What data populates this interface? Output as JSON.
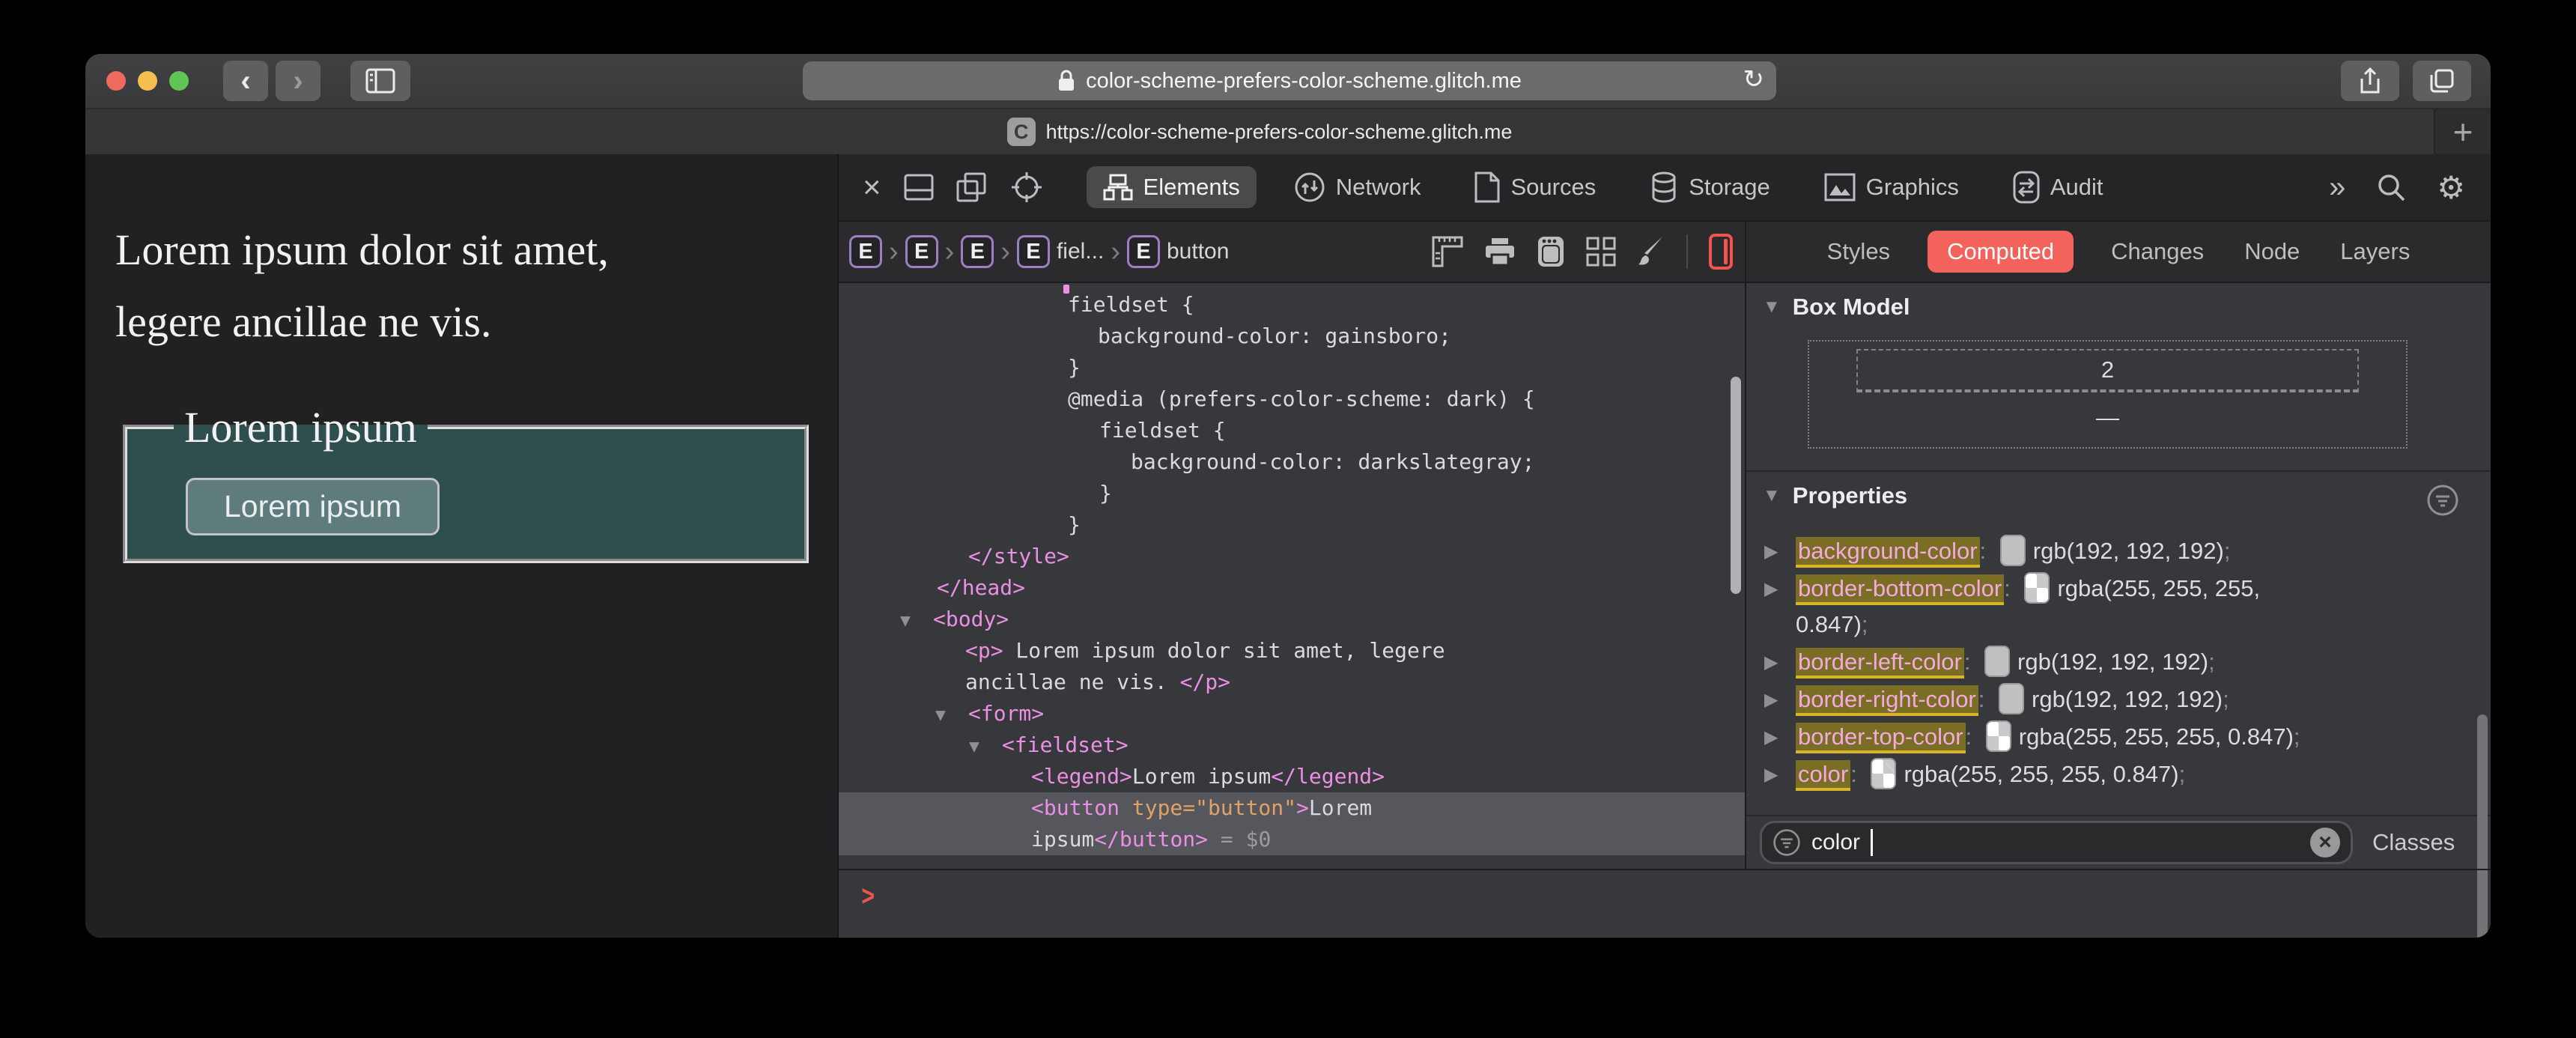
{
  "colors": {
    "computed-tab": "#f3625b",
    "prompt": "#f2544d",
    "tag-pink": "#ea8fe3",
    "attr-orange": "#e2a266",
    "highlight-bg": "#7a6e25",
    "highlight-underline": "#d9b32a",
    "prop-pink": "#f4a9df",
    "fieldset-bg": "#2f4f4f",
    "button-bg": "#5e7c7b",
    "button-border": "#c3c3c3"
  },
  "glyphs": {
    "back": "‹",
    "forward": "›",
    "reload": "↻",
    "plus": "+",
    "close": "×",
    "overflow": "»",
    "gear": "⚙",
    "separator": "›",
    "prompt": ">",
    "clear": "×",
    "collapse": "▼",
    "expand": "▶"
  },
  "titlebar": {
    "url": "color-scheme-prefers-color-scheme.glitch.me"
  },
  "tabbar": {
    "favicon_letter": "C",
    "tab_url": "https://color-scheme-prefers-color-scheme.glitch.me"
  },
  "page": {
    "paragraph": "Lorem ipsum dolor sit amet, legere ancillae ne vis.",
    "fieldset_legend": "Lorem ipsum",
    "button_label": "Lorem ipsum"
  },
  "devtools": {
    "toolbar": {
      "tabs": [
        {
          "label": "Elements",
          "active": true
        },
        {
          "label": "Network"
        },
        {
          "label": "Sources"
        },
        {
          "label": "Storage"
        },
        {
          "label": "Graphics"
        },
        {
          "label": "Audit"
        }
      ]
    },
    "breadcrumbs": {
      "items": [
        {
          "tag": "E",
          "label": ""
        },
        {
          "tag": "E",
          "label": ""
        },
        {
          "tag": "E",
          "label": ""
        },
        {
          "tag": "E",
          "label": "fiel..."
        },
        {
          "tag": "E",
          "label": "button"
        }
      ]
    },
    "code_lines": [
      {
        "indent": 306,
        "segs": [
          [
            "plain",
            "fieldset {"
          ]
        ]
      },
      {
        "indent": 346,
        "segs": [
          [
            "plain",
            "background-color: gainsboro;"
          ]
        ]
      },
      {
        "indent": 306,
        "segs": [
          [
            "plain",
            "}"
          ]
        ]
      },
      {
        "indent": 306,
        "segs": [
          [
            "plain",
            "@media (prefers-color-scheme: dark) {"
          ]
        ]
      },
      {
        "indent": 348,
        "segs": [
          [
            "plain",
            "fieldset {"
          ]
        ]
      },
      {
        "indent": 390,
        "segs": [
          [
            "plain",
            "background-color: darkslategray;"
          ]
        ]
      },
      {
        "indent": 348,
        "segs": [
          [
            "plain",
            "}"
          ]
        ]
      },
      {
        "indent": 306,
        "segs": [
          [
            "plain",
            "}"
          ]
        ]
      },
      {
        "indent": 173,
        "segs": [
          [
            "tag",
            "</style>"
          ]
        ]
      },
      {
        "indent": 131,
        "segs": [
          [
            "tag",
            "</head>"
          ]
        ]
      },
      {
        "indent": 126,
        "tri": true,
        "segs": [
          [
            "tag",
            "<body>"
          ]
        ]
      },
      {
        "indent": 169,
        "segs": [
          [
            "tag",
            "<p>"
          ],
          [
            "plain",
            " Lorem ipsum dolor sit amet, legere"
          ]
        ]
      },
      {
        "indent": 169,
        "segs": [
          [
            "plain",
            "ancillae ne vis. "
          ],
          [
            "tag",
            "</p>"
          ]
        ]
      },
      {
        "indent": 173,
        "tri": true,
        "segs": [
          [
            "tag",
            "<form>"
          ]
        ]
      },
      {
        "indent": 218,
        "tri": true,
        "segs": [
          [
            "tag",
            "<fieldset>"
          ]
        ]
      },
      {
        "indent": 257,
        "segs": [
          [
            "tag",
            "<legend>"
          ],
          [
            "plain",
            "Lorem ipsum"
          ],
          [
            "tag",
            "</legend>"
          ]
        ]
      },
      {
        "indent": 257,
        "sel": true,
        "segs": [
          [
            "tag",
            "<button "
          ],
          [
            "attr",
            "type=\"button\""
          ],
          [
            "tag",
            ">"
          ],
          [
            "plain",
            "Lorem"
          ]
        ]
      },
      {
        "indent": 257,
        "sel": true,
        "segs": [
          [
            "plain",
            "ipsum"
          ],
          [
            "tag",
            "</button>"
          ],
          [
            "dim",
            " = $0"
          ]
        ]
      }
    ],
    "right_panel": {
      "tabs": [
        {
          "label": "Styles"
        },
        {
          "label": "Computed",
          "active": true
        },
        {
          "label": "Changes"
        },
        {
          "label": "Node"
        },
        {
          "label": "Layers"
        }
      ],
      "box_model": {
        "title": "Box Model",
        "border_bottom_width": "2",
        "dash": "—"
      },
      "properties": {
        "title": "Properties",
        "rows": [
          {
            "name": "background-color",
            "value": "rgb(192, 192, 192)",
            "alpha": false
          },
          {
            "name": "border-bottom-color",
            "value": "rgba(255, 255, 255,",
            "value2": "0.847)",
            "alpha": true
          },
          {
            "name": "border-left-color",
            "value": "rgb(192, 192, 192)",
            "alpha": false
          },
          {
            "name": "border-right-color",
            "value": "rgb(192, 192, 192)",
            "alpha": false
          },
          {
            "name": "border-top-color",
            "value": "rgba(255, 255, 255, 0.847)",
            "alpha": true
          },
          {
            "name": "color",
            "value": "rgba(255, 255, 255, 0.847)",
            "alpha": true
          }
        ]
      },
      "filter": {
        "value": "color",
        "classes_label": "Classes"
      }
    }
  }
}
